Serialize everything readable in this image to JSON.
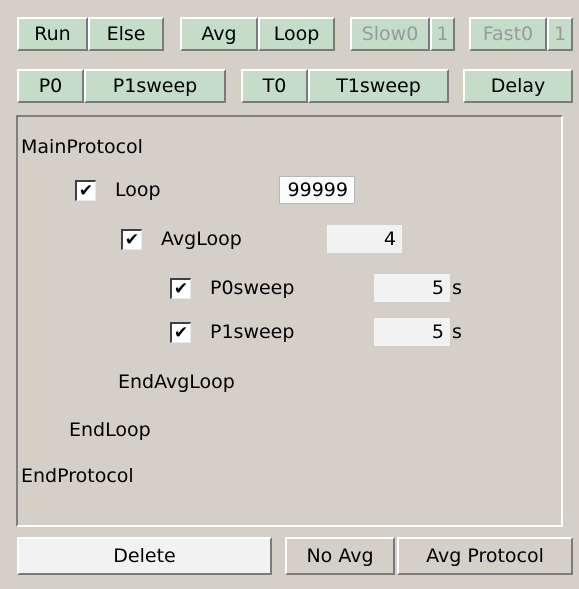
{
  "toolbar1": {
    "run": "Run",
    "else": "Else",
    "avg": "Avg",
    "loop": "Loop",
    "slow0": "Slow0",
    "slow_num": "1",
    "fast0": "Fast0",
    "fast_num": "1"
  },
  "toolbar2": {
    "p0": "P0",
    "p1sweep": "P1sweep",
    "t0": "T0",
    "t1sweep": "T1sweep",
    "delay": "Delay"
  },
  "protocol": {
    "main": "MainProtocol",
    "loop": {
      "label": "Loop",
      "checked": "✔",
      "value": "99999"
    },
    "avgloop": {
      "label": "AvgLoop",
      "checked": "✔",
      "value": "4"
    },
    "p0sweep": {
      "label": "P0sweep",
      "checked": "✔",
      "value": "5",
      "unit": "s"
    },
    "p1sweep": {
      "label": "P1sweep",
      "checked": "✔",
      "value": "5",
      "unit": "s"
    },
    "end_avgloop": "EndAvgLoop",
    "end_loop": "EndLoop",
    "end_protocol": "EndProtocol"
  },
  "bottom": {
    "delete": "Delete",
    "no_avg": "No Avg",
    "avg_protocol": "Avg Protocol"
  },
  "colors": {
    "button_bg": "#c4dcc8",
    "window_bg": "#d4d0c8",
    "disabled_text": "#9a9a9a"
  }
}
